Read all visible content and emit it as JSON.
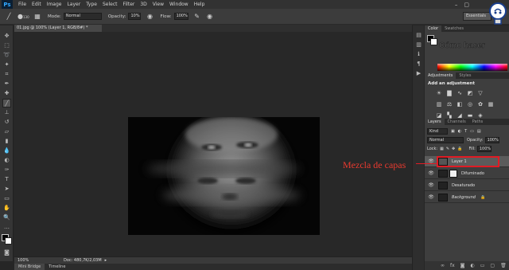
{
  "app": {
    "logo": "Ps",
    "menus": [
      "File",
      "Edit",
      "Image",
      "Layer",
      "Type",
      "Select",
      "Filter",
      "3D",
      "View",
      "Window",
      "Help"
    ]
  },
  "options": {
    "brush_size": "130",
    "mode_label": "Mode:",
    "mode_value": "Normal",
    "opacity_label": "Opacity:",
    "opacity_value": "10%",
    "flow_label": "Flow:",
    "flow_value": "100%",
    "workspace": "Essentials"
  },
  "document": {
    "tab_title": "01.jpg @ 100% (Layer 1, RGB/8#) *",
    "zoom": "100%",
    "doc_info": "Doc: 480,7K/2,03M"
  },
  "bottom_tabs": [
    "Mini Bridge",
    "Timeline"
  ],
  "color_panel": {
    "tabs": [
      "Color",
      "Swatches"
    ],
    "watermark": "Cómo hacer"
  },
  "adjustments_panel": {
    "tabs": [
      "Adjustments",
      "Styles"
    ],
    "title": "Add an adjustment"
  },
  "layers_panel": {
    "tabs": [
      "Layers",
      "Channels",
      "Paths"
    ],
    "filter_kind": "Kind",
    "blend_mode": "Normal",
    "opacity_label": "Opacity:",
    "opacity_value": "100%",
    "lock_label": "Lock:",
    "fill_label": "Fill:",
    "fill_value": "100%",
    "layers": [
      {
        "name": "Layer 1",
        "selected": true,
        "has_mask": false,
        "italic": false
      },
      {
        "name": "Difuminado",
        "selected": false,
        "has_mask": true,
        "italic": false
      },
      {
        "name": "Desaturado",
        "selected": false,
        "has_mask": false,
        "italic": false
      },
      {
        "name": "Background",
        "selected": false,
        "has_mask": false,
        "italic": true
      }
    ]
  },
  "annotation": {
    "text": "Mezcla de capas",
    "color": "#e01b24"
  }
}
